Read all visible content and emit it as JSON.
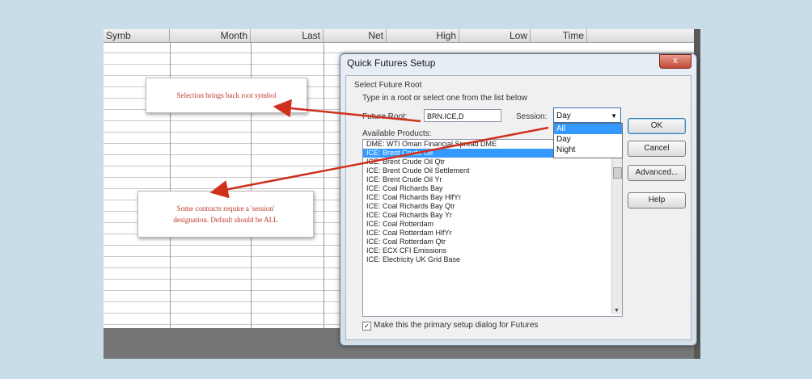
{
  "sheet": {
    "columns": [
      "Symb",
      "Month",
      "Last",
      "Net",
      "High",
      "Low",
      "Time"
    ]
  },
  "dialog": {
    "title": "Quick Futures Setup",
    "close_label": "x",
    "group_label": "Select Future Root",
    "instruction": "Type in a root or select one from the list below",
    "future_root_label": "Future Root:",
    "future_root_value": "BRN.ICE,D",
    "session_label": "Session:",
    "session_value": "Day",
    "session_options": [
      "All",
      "Day",
      "Night"
    ],
    "available_label": "Available Products:",
    "products": [
      "DME: WTI Oman Financial Spread DME",
      "ICE: Brent Crude Oil",
      "ICE: Brent Crude Oil Qtr",
      "ICE: Brent Crude Oil Settlement",
      "ICE: Brent Crude Oil Yr",
      "ICE: Coal Richards Bay",
      "ICE: Coal Richards Bay HlfYr",
      "ICE: Coal Richards Bay Qtr",
      "ICE: Coal Richards Bay Yr",
      "ICE: Coal Rotterdam",
      "ICE: Coal Rotterdam HlfYr",
      "ICE: Coal Rotterdam Qtr",
      "ICE: ECX CFI Emissions",
      "ICE: Electricity UK Grid Base"
    ],
    "primary_check_mark": "✓",
    "primary_label": "Make this the primary setup dialog for Futures",
    "buttons": {
      "ok": "OK",
      "cancel": "Cancel",
      "advanced": "Advanced...",
      "help": "Help"
    }
  },
  "annotations": {
    "callout_1": "Selection brings back root symbol",
    "callout_2_line1": "Some contracts require a 'session'",
    "callout_2_line2": "designation.  Default should be ALL"
  },
  "colors": {
    "annotation_text": "#c0392b",
    "arrow": "#d0301e",
    "selection": "#3399ff"
  }
}
